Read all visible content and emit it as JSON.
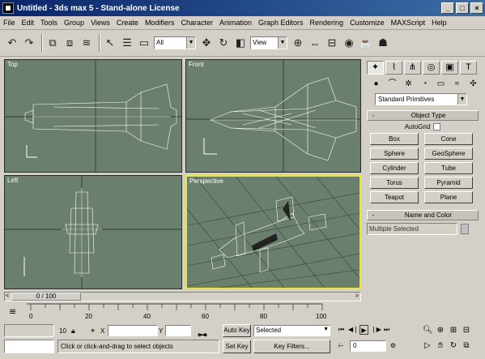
{
  "window": {
    "title": "Untitled - 3ds max 5 - Stand-alone License",
    "buttons": {
      "minimize": "_",
      "maximize": "□",
      "close": "×"
    }
  },
  "menu": [
    "File",
    "Edit",
    "Tools",
    "Group",
    "Views",
    "Create",
    "Modifiers",
    "Character",
    "Animation",
    "Graph Editors",
    "Rendering",
    "Customize",
    "MAXScript",
    "Help"
  ],
  "toolbar": {
    "selection_filter": "All",
    "reference_coord": "View"
  },
  "viewports": {
    "top": "Top",
    "front": "Front",
    "left": "Left",
    "perspective": "Perspective"
  },
  "command_panel": {
    "tab_icons": [
      "create-tab-icon",
      "modify-tab-icon",
      "hierarchy-tab-icon",
      "motion-tab-icon",
      "display-tab-icon",
      "utilities-tab-icon"
    ],
    "category_dropdown": "Standard Primitives",
    "object_type": {
      "header": "Object Type",
      "sign": "-",
      "autogrid_label": "AutoGrid",
      "buttons": [
        "Box",
        "Cone",
        "Sphere",
        "GeoSphere",
        "Cylinder",
        "Tube",
        "Torus",
        "Pyramid",
        "Teapot",
        "Plane"
      ]
    },
    "name_color": {
      "header": "Name and Color",
      "sign": "-",
      "name_value": "Multiple Selected"
    }
  },
  "time_slider": {
    "label": "0 / 100",
    "prev": "<",
    "next": ">"
  },
  "trackbar": {
    "ticks": [
      "0",
      "20",
      "40",
      "60",
      "80",
      "100"
    ]
  },
  "status": {
    "selection_count": "10",
    "x_label": "X",
    "y_label": "Y",
    "z_label": "Z",
    "prompt": "Click or click-and-drag to select objects",
    "auto_key": "Auto Key",
    "set_key": "Set Key",
    "key_mode": "Selected",
    "key_filters": "Key Filters...",
    "current_frame": "0"
  },
  "colors": {
    "viewport_bg": "#6b7f6e",
    "active_viewport_border": "#e8e830",
    "title_bar": "#0a246a"
  }
}
